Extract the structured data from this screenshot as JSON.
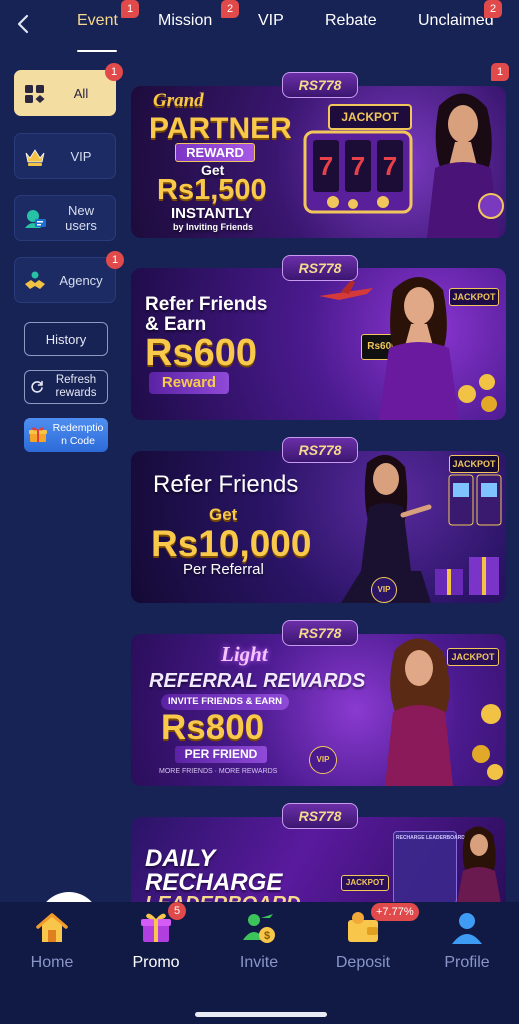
{
  "tabs": [
    {
      "label": "Event",
      "badge": "1",
      "active": true
    },
    {
      "label": "Mission",
      "badge": "2"
    },
    {
      "label": "VIP"
    },
    {
      "label": "Rebate"
    },
    {
      "label": "Unclaimed",
      "badge": "2"
    }
  ],
  "categories": [
    {
      "label": "All",
      "badge": "1",
      "icon": "grid-icon",
      "active": true
    },
    {
      "label": "VIP",
      "icon": "crown-icon"
    },
    {
      "label": "New users",
      "icon": "user-card-icon"
    },
    {
      "label": "Agency",
      "badge": "1",
      "icon": "handshake-icon"
    }
  ],
  "side_buttons": {
    "history": "History",
    "refresh": "Refresh rewards",
    "redeem": "Redemption Code"
  },
  "brand": "RS778",
  "banners": [
    {
      "badge": "1",
      "title_script": "Grand",
      "title": "PARTNER",
      "ribbon": "REWARD",
      "line1": "Get",
      "amount": "Rs1,500",
      "line2": "INSTANTLY",
      "line3": "by Inviting Friends",
      "jackpot": "JACKPOT"
    },
    {
      "title": "Refer Friends",
      "title2": "& Earn",
      "amount": "Rs600",
      "ribbon": "Reward",
      "chip": "Rs600",
      "jackpot": "JACKPOT"
    },
    {
      "title": "Refer Friends",
      "line1": "Get",
      "amount": "Rs10,000",
      "line2": "Per Referral",
      "jackpot": "JACKPOT",
      "chip": "VIP"
    },
    {
      "title_script": "Light",
      "title": "REFERRAL REWARDS",
      "line1": "INVITE FRIENDS & EARN",
      "amount": "Rs800",
      "ribbon": "PER FRIEND",
      "line2": "MORE FRIENDS · MORE REWARDS",
      "jackpot": "JACKPOT",
      "chip": "VIP"
    },
    {
      "title": "DAILY",
      "title2": "RECHARGE",
      "title3": "LEADERBOARD",
      "jackpot": "JACKPOT",
      "panel": "RECHARGE LEADERBOARD"
    }
  ],
  "nav": [
    {
      "label": "Home",
      "icon": "home-icon"
    },
    {
      "label": "Promo",
      "icon": "gift-icon",
      "badge": "5",
      "active": true
    },
    {
      "label": "Invite",
      "icon": "invite-icon"
    },
    {
      "label": "Deposit",
      "icon": "wallet-icon",
      "badge": "+7.77%"
    },
    {
      "label": "Profile",
      "icon": "profile-icon"
    }
  ],
  "colors": {
    "background": "#172255",
    "accent_gold": "#f5d98c",
    "badge_red": "#e14a4a",
    "nav_bg": "#101a45"
  }
}
